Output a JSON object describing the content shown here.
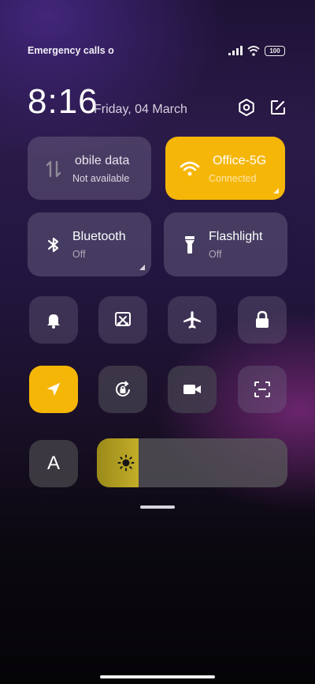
{
  "status_bar": {
    "carrier_text": "Emergency calls o",
    "battery": "100"
  },
  "header": {
    "time": "8:16",
    "date": "Friday, 04 March"
  },
  "tiles": {
    "mobile_data": {
      "label": "obile data",
      "sub": "Not available"
    },
    "wifi": {
      "label": "Office-5G",
      "sub": "Connected"
    },
    "bluetooth": {
      "label": "Bluetooth",
      "sub": "Off"
    },
    "flashlight": {
      "label": "Flashlight",
      "sub": "Off"
    }
  },
  "toggles_row1": [
    "bell-icon",
    "screenshot-icon",
    "airplane-icon",
    "lock-icon"
  ],
  "toggles_row2": [
    "location-icon",
    "rotation-lock-icon",
    "video-icon",
    "scan-icon"
  ],
  "font_button": {
    "label": "A"
  },
  "brightness": {
    "level": 0.22,
    "icon": "sun-icon"
  },
  "colors": {
    "accent": "#f6b608",
    "tile_gray": "#6e6a86"
  }
}
